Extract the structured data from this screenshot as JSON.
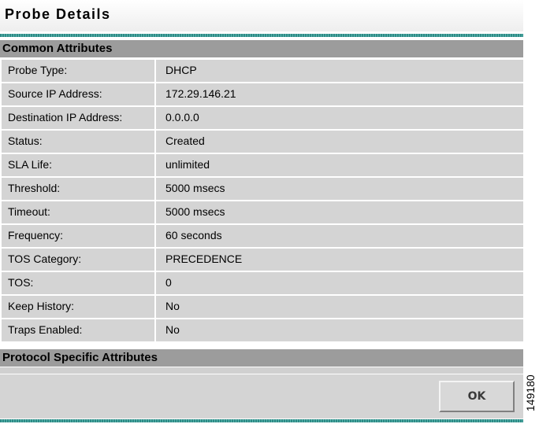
{
  "window": {
    "title": "Probe Details"
  },
  "sections": {
    "common": "Common Attributes",
    "protocol": "Protocol Specific Attributes"
  },
  "attributes": [
    {
      "label": "Probe Type:",
      "value": "DHCP"
    },
    {
      "label": "Source IP Address:",
      "value": "172.29.146.21"
    },
    {
      "label": "Destination IP Address:",
      "value": "0.0.0.0"
    },
    {
      "label": "Status:",
      "value": "Created"
    },
    {
      "label": "SLA Life:",
      "value": "unlimited"
    },
    {
      "label": "Threshold:",
      "value": "5000 msecs"
    },
    {
      "label": "Timeout:",
      "value": "5000 msecs"
    },
    {
      "label": "Frequency:",
      "value": "60 seconds"
    },
    {
      "label": "TOS Category:",
      "value": "PRECEDENCE"
    },
    {
      "label": "TOS:",
      "value": "0"
    },
    {
      "label": "Keep History:",
      "value": "No"
    },
    {
      "label": "Traps Enabled:",
      "value": "No"
    }
  ],
  "buttons": {
    "ok": "OK"
  },
  "figure_number": "149180"
}
